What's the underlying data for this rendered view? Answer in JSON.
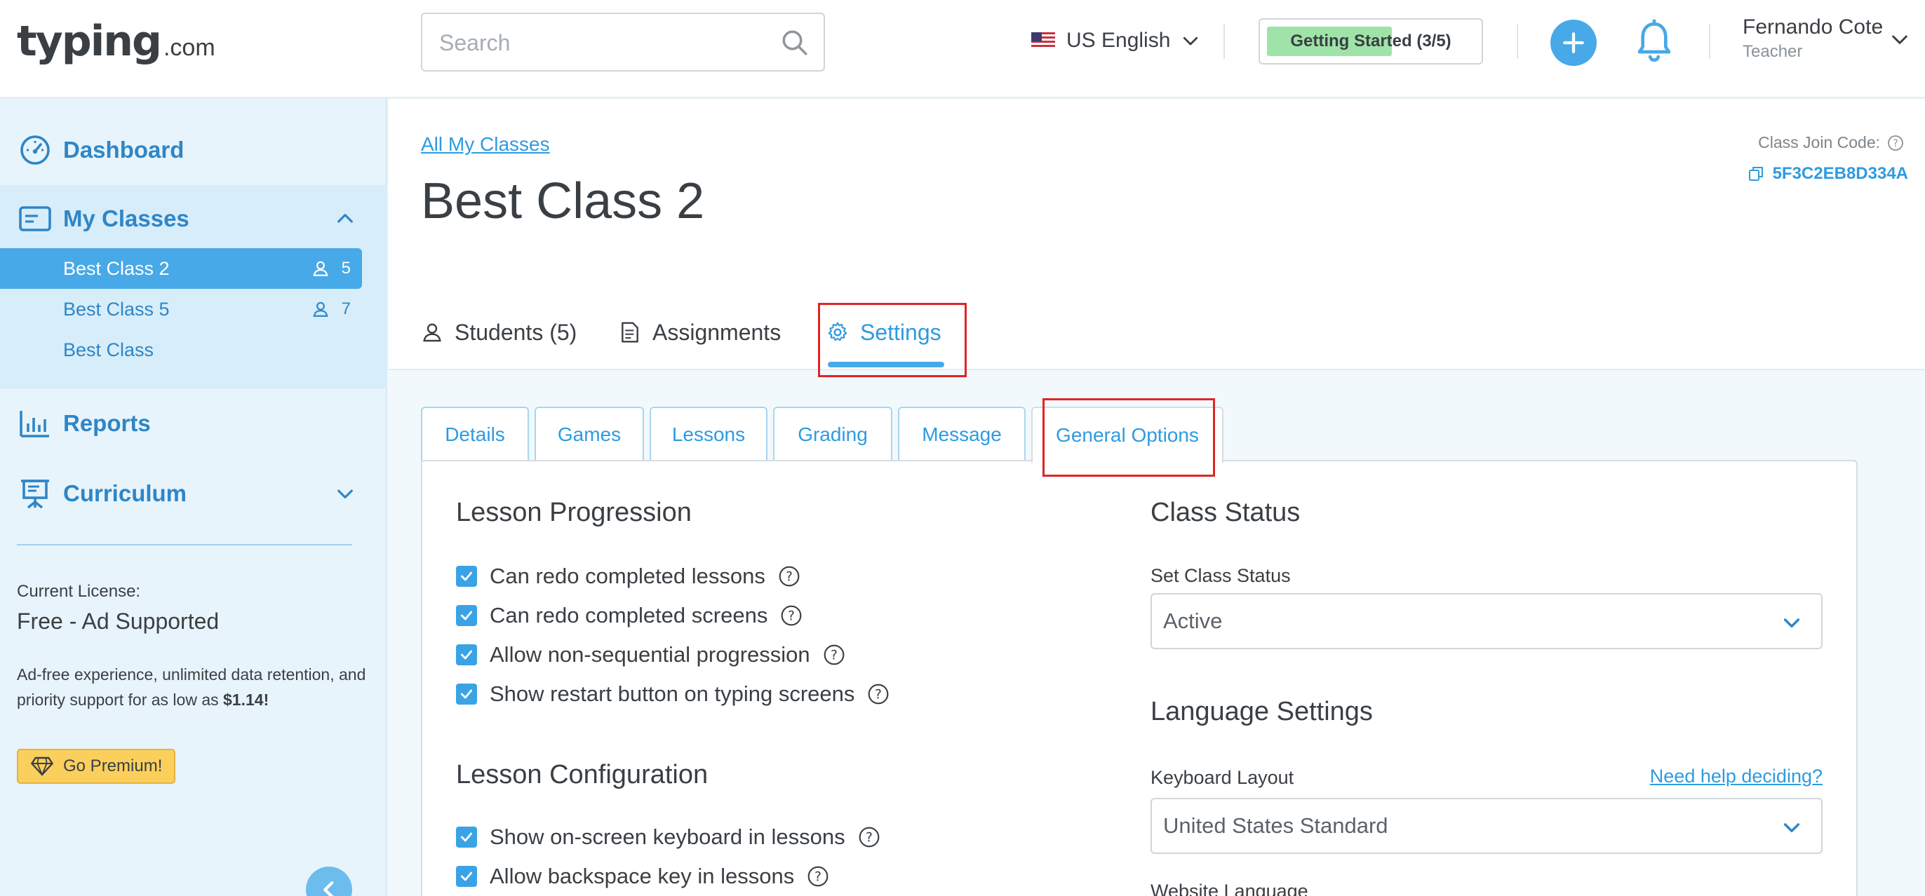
{
  "header": {
    "logo_main": "typing",
    "logo_sub": ".com",
    "search_placeholder": "Search",
    "language": "US English",
    "getting_started_label": "Getting Started (3/5)",
    "getting_started_progress": 0.6,
    "user_name": "Fernando Cote",
    "user_role": "Teacher"
  },
  "sidebar": {
    "dashboard": "Dashboard",
    "my_classes": "My Classes",
    "classes": [
      {
        "name": "Best Class 2",
        "count": "5",
        "active": true
      },
      {
        "name": "Best Class 5",
        "count": "7",
        "active": false
      },
      {
        "name": "Best Class",
        "count": "",
        "active": false
      }
    ],
    "reports": "Reports",
    "curriculum": "Curriculum",
    "license_label": "Current License:",
    "license_value": "Free - Ad Supported",
    "license_desc": "Ad-free experience, unlimited data retention, and priority support for as low as",
    "license_price": "$1.14!",
    "premium_label": "Go Premium!"
  },
  "main": {
    "breadcrumb": "All My Classes",
    "title": "Best Class 2",
    "join_label": "Class Join Code:",
    "join_code": "5F3C2EB8D334A",
    "tabs": {
      "students": "Students (5)",
      "assignments": "Assignments",
      "settings": "Settings"
    },
    "subtabs": {
      "details": "Details",
      "games": "Games",
      "lessons": "Lessons",
      "grading": "Grading",
      "message": "Message",
      "general": "General Options"
    }
  },
  "settings": {
    "lesson_progression": {
      "title": "Lesson Progression",
      "options": [
        "Can redo completed lessons",
        "Can redo completed screens",
        "Allow non-sequential progression",
        "Show restart button on typing screens"
      ]
    },
    "lesson_configuration": {
      "title": "Lesson Configuration",
      "options": [
        "Show on-screen keyboard in lessons",
        "Allow backspace key in lessons"
      ]
    },
    "class_status": {
      "title": "Class Status",
      "label": "Set Class Status",
      "value": "Active"
    },
    "language_settings": {
      "title": "Language Settings",
      "keyboard_label": "Keyboard Layout",
      "help_link": "Need help deciding?",
      "keyboard_value": "United States Standard",
      "website_language_label": "Website Language"
    }
  },
  "colors": {
    "accent": "#47a9e8",
    "link": "#2e9be0",
    "highlight": "#e02424",
    "progress": "#9fe3a8",
    "premium": "#fbcf5c"
  }
}
